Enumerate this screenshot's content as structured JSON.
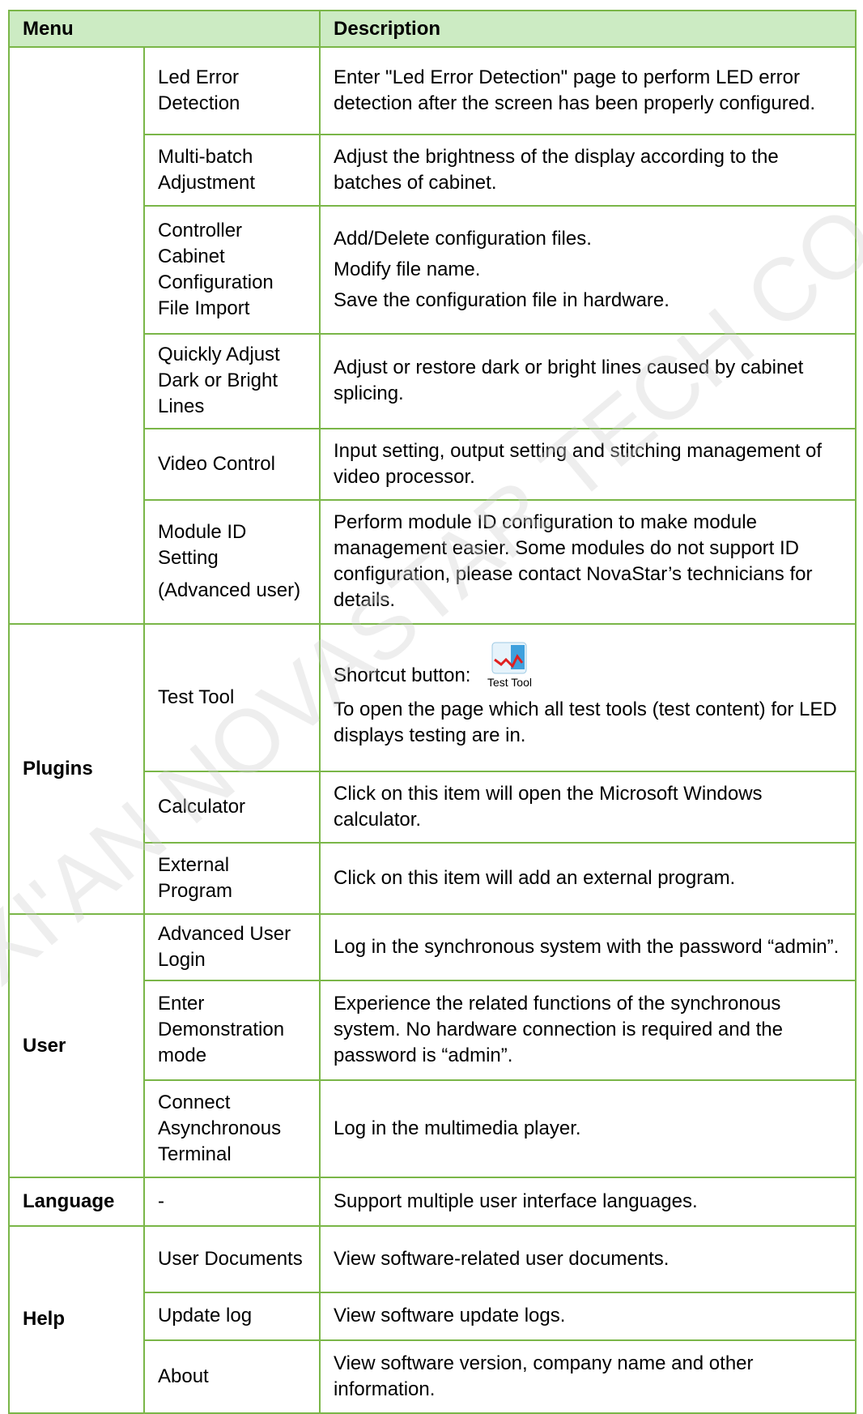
{
  "header": {
    "menu": "Menu",
    "description": "Description"
  },
  "rows": {
    "r0": {
      "item": "Led Error Detection",
      "desc": [
        "Enter \"Led Error Detection\" page to perform LED error detection after the screen has been properly configured."
      ]
    },
    "r1": {
      "item": "Multi-batch Adjustment",
      "desc": [
        "Adjust the brightness of the display according to the batches of cabinet."
      ]
    },
    "r2": {
      "item": "Controller Cabinet Configuration File Import",
      "desc": [
        "Add/Delete configuration files.",
        "Modify file name.",
        "Save the configuration file in hardware."
      ]
    },
    "r3": {
      "item": "Quickly Adjust Dark or Bright Lines",
      "desc": [
        "Adjust or restore dark or bright lines caused by cabinet splicing."
      ]
    },
    "r4": {
      "item": "Video Control",
      "desc": [
        "Input setting, output setting and stitching management of video processor."
      ]
    },
    "r5": {
      "item": "Module ID Setting",
      "item_extra": "(Advanced user)",
      "desc": [
        "Perform module ID configuration to make module management easier. Some modules do not support ID configuration, please contact NovaStar’s technicians for details."
      ]
    },
    "plugins": {
      "group": "Plugins",
      "test_tool": {
        "item": "Test Tool",
        "shortcut_label": "Shortcut button:",
        "icon_label": "Test Tool",
        "desc": "To open the page which all test tools (test content) for LED displays testing are in."
      },
      "calculator": {
        "item": "Calculator",
        "desc": "Click on this item will open the Microsoft Windows calculator."
      },
      "external": {
        "item": "External Program",
        "desc": "Click on this item will add an external program."
      }
    },
    "user": {
      "group": "User",
      "advanced": {
        "item": "Advanced User Login",
        "desc": "Log in the synchronous system with the password “admin”."
      },
      "demo": {
        "item": "Enter Demonstration mode",
        "desc": "Experience the related functions of the synchronous system. No hardware connection is required and the password is “admin”."
      },
      "async": {
        "item": "Connect Asynchronous Terminal",
        "desc": "Log in the multimedia player."
      }
    },
    "language": {
      "group": "Language",
      "item": "-",
      "desc": "Support multiple user interface languages."
    },
    "help": {
      "group": "Help",
      "docs": {
        "item": "User Documents",
        "desc": "View software-related user documents."
      },
      "update": {
        "item": "Update log",
        "desc": "View software update logs."
      },
      "about": {
        "item": "About",
        "desc": "View software version, company name and other information."
      }
    }
  },
  "watermark": "XI'AN NOVASTAR TECH CO., LTD.",
  "colors": {
    "border": "#7ab648",
    "header_bg": "#ccebc3",
    "watermark": "#ececec"
  }
}
